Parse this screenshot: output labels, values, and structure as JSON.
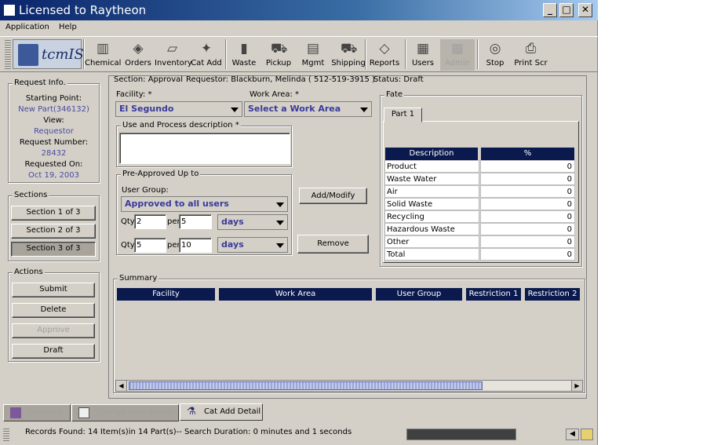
{
  "window": {
    "title": "Licensed to Raytheon",
    "minimize": "_",
    "maximize": "□",
    "close": "✕"
  },
  "menu": [
    "Application",
    "Help"
  ],
  "logo_text": "tcmIS",
  "toolbar": [
    {
      "label": "Chemical",
      "icon": "chemical-icon",
      "glyph": "▥",
      "disabled": false
    },
    {
      "label": "Orders",
      "icon": "orders-icon",
      "glyph": "◈",
      "disabled": false
    },
    {
      "label": "Inventory",
      "icon": "inventory-icon",
      "glyph": "▱",
      "disabled": false
    },
    {
      "label": "Cat Add",
      "icon": "cat-add-icon",
      "glyph": "✦",
      "disabled": false
    },
    {
      "label": "Waste",
      "icon": "waste-icon",
      "glyph": "▮",
      "disabled": false
    },
    {
      "label": "Pickup",
      "icon": "pickup-icon",
      "glyph": "⛟",
      "disabled": false
    },
    {
      "label": "Mgmt",
      "icon": "mgmt-icon",
      "glyph": "▤",
      "disabled": false
    },
    {
      "label": "Shipping",
      "icon": "shipping-icon",
      "glyph": "⛟",
      "disabled": false
    },
    {
      "label": "Reports",
      "icon": "reports-icon",
      "glyph": "◇",
      "disabled": false
    },
    {
      "label": "Users",
      "icon": "users-icon",
      "glyph": "▦",
      "disabled": false
    },
    {
      "label": "Admin",
      "icon": "admin-icon",
      "glyph": "▦",
      "disabled": true
    },
    {
      "label": "Stop",
      "icon": "stop-icon",
      "glyph": "◎",
      "disabled": false
    },
    {
      "label": "Print Scr",
      "icon": "print-icon",
      "glyph": "⎙",
      "disabled": false
    }
  ],
  "request_info": {
    "legend": "Request Info.",
    "starting_point_label": "Starting Point:",
    "starting_point": "New Part(346132)",
    "view_label": "View:",
    "view": "Requestor",
    "request_number_label": "Request Number:",
    "request_number": "28432",
    "requested_on_label": "Requested On:",
    "requested_on": "Oct 19, 2003"
  },
  "sections": {
    "legend": "Sections",
    "items": [
      "Section 1 of 3",
      "Section 2 of 3",
      "Section 3 of 3"
    ]
  },
  "actions": {
    "legend": "Actions",
    "submit": "Submit",
    "delete": "Delete",
    "approve": "Approve",
    "draft": "Draft"
  },
  "header": {
    "section": "Section: Approval",
    "requestor": "Requestor: Blackburn, Melinda  ( 512-519-3915 )",
    "status": "Status: Draft"
  },
  "form": {
    "facility_label": "Facility: *",
    "facility_value": "El Segundo",
    "work_area_label": "Work Area: *",
    "work_area_value": "Select a Work Area",
    "use_desc_legend": "Use and Process description *",
    "use_desc_value": "",
    "preapproved_legend": "Pre-Approved Up to",
    "user_group_label": "User Group:",
    "user_group_value": "Approved to all users",
    "qty_label": "Qty",
    "per_label": "per",
    "row1": {
      "qty": "2",
      "per": "5",
      "unit": "days"
    },
    "row2": {
      "qty": "5",
      "per": "10",
      "unit": "days"
    },
    "add_modify": "Add/Modify",
    "remove": "Remove"
  },
  "fate": {
    "legend": "Fate",
    "tab": "Part 1",
    "col_desc": "Description",
    "col_pct": "%",
    "rows": [
      {
        "d": "Product",
        "p": "0"
      },
      {
        "d": "Waste Water",
        "p": "0"
      },
      {
        "d": "Air",
        "p": "0"
      },
      {
        "d": "Solid Waste",
        "p": "0"
      },
      {
        "d": "Recycling",
        "p": "0"
      },
      {
        "d": "Hazardous Waste",
        "p": "0"
      },
      {
        "d": "Other",
        "p": "0"
      },
      {
        "d": "Total",
        "p": "0"
      }
    ]
  },
  "summary": {
    "legend": "Summary",
    "columns": [
      "Facility",
      "Work Area",
      "User Group",
      "Restriction 1",
      "Restriction 2"
    ]
  },
  "bottom_tabs": [
    "Chemical",
    "Change User Profile",
    "Cat Add Detail"
  ],
  "status": "Records Found: 14 Item(s)in 14 Part(s)-- Search Duration: 0 minutes and 1 seconds"
}
